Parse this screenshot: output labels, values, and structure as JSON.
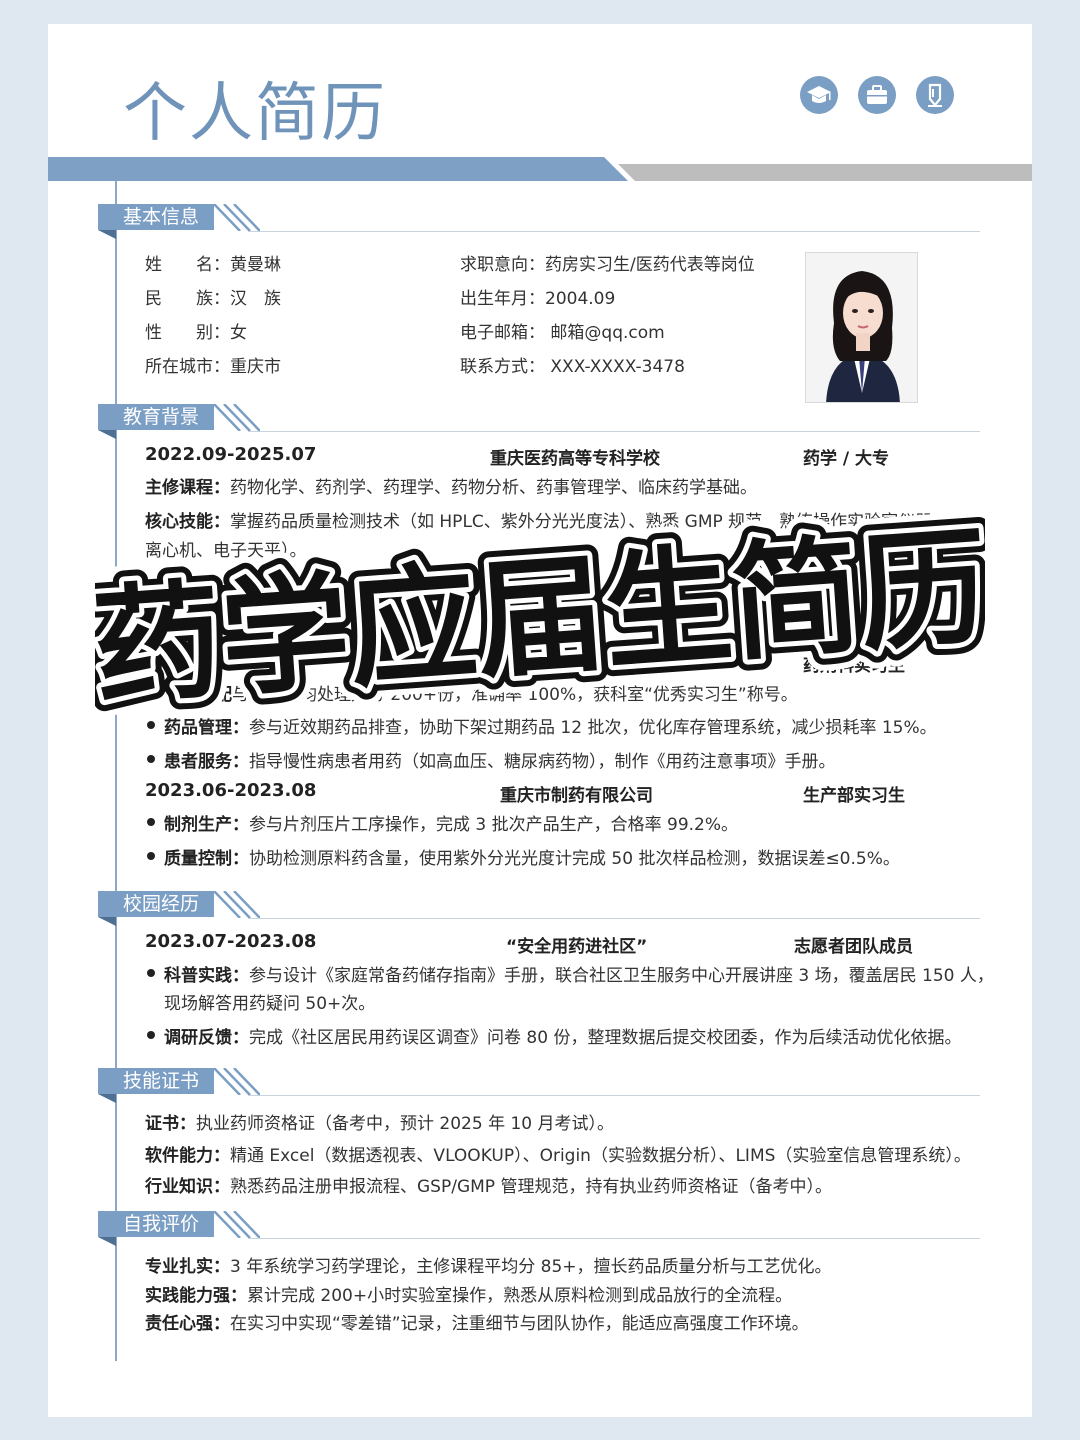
{
  "header": {
    "title": "个人简历",
    "icons": [
      "graduation-cap-icon",
      "briefcase-icon",
      "pen-icon"
    ]
  },
  "colors": {
    "accent": "#7b9ec4",
    "accent_dark": "#4f6f93",
    "band_gray": "#bdbdbd",
    "background": "#dfe8f0"
  },
  "sections": {
    "basic": "基本信息",
    "education": "教育背景",
    "campus": "校园经历",
    "skills": "技能证书",
    "self_eval": "自我评价"
  },
  "basic_info": {
    "name": "姓　　名：黄曼琳",
    "ethnicity": "民　　族：汉　族",
    "gender": "性　　别：女",
    "city": "所在城市：重庆市",
    "job_intent": "求职意向：药房实习生/医药代表等岗位",
    "birth": "出生年月：2004.09",
    "email": "电子邮箱： 邮箱@qq.com",
    "phone": "联系方式： XXX-XXXX-3478"
  },
  "education": {
    "period": "2022.09-2025.07",
    "school": "重庆医药高等专科学校",
    "major": "药学 / 大专",
    "courses_label": "主修课程：",
    "courses": "药物化学、药剂学、药理学、药物分析、药事管理学、临床药学基础。",
    "core_label": "核心技能：",
    "core_line1": "掌握药品质量检测技术（如 HPLC、紫外分光光度法）、熟悉 GMP 规范、熟练操作实验室仪器",
    "core_line2": "离心机、电子天平）。",
    "honor_label": "荣誉奖项：",
    "honor": "202"
  },
  "work": {
    "job1_role": "药剂科实习生",
    "job1_item1_text": "与发放：均处理处方 200+份，准确率 100%，获科室“优秀实习生”称号。",
    "job1_item2_label": "药品管理：",
    "job1_item2_text": "参与近效期药品排查，协助下架过期药品 12 批次，优化库存管理系统，减少损耗率 15%。",
    "job1_item3_label": "患者服务：",
    "job1_item3_text": "指导慢性病患者用药（如高血压、糖尿病药物），制作《用药注意事项》手册。",
    "job2_period": "2023.06-2023.08",
    "job2_company": "重庆市制药有限公司",
    "job2_role": "生产部实习生",
    "job2_item1_label": "制剂生产：",
    "job2_item1_text": "参与片剂压片工序操作，完成 3 批次产品生产，合格率 99.2%。",
    "job2_item2_label": "质量控制：",
    "job2_item2_text": "协助检测原料药含量，使用紫外分光光度计完成 50 批次样品检测，数据误差≤0.5%。"
  },
  "campus": {
    "period": "2023.07-2023.08",
    "activity": "“安全用药进社区”",
    "role": "志愿者团队成员",
    "item1_label": "科普实践：",
    "item1_line1": "参与设计《家庭常备药储存指南》手册，联合社区卫生服务中心开展讲座 3 场，覆盖居民 150 人，",
    "item1_line2": "现场解答用药疑问 50+次。",
    "item2_label": "调研反馈：",
    "item2_text": "完成《社区居民用药误区调查》问卷 80 份，整理数据后提交校团委，作为后续活动优化依据。"
  },
  "skills": {
    "cert_label": "证书：",
    "cert": "执业药师资格证（备考中，预计 2025 年 10 月考试）。",
    "software_label": "软件能力：",
    "software": "精通 Excel（数据透视表、VLOOKUP）、Origin（实验数据分析）、LIMS（实验室信息管理系统）。",
    "industry_label": "行业知识：",
    "industry": "熟悉药品注册申报流程、GSP/GMP 管理规范，持有执业药师资格证（备考中）。"
  },
  "self_eval": {
    "item1_label": "专业扎实：",
    "item1": "3 年系统学习药学理论，主修课程平均分 85+，擅长药品质量分析与工艺优化。",
    "item2_label": "实践能力强：",
    "item2": "累计完成 200+小时实验室操作，熟悉从原料检测到成品放行的全流程。",
    "item3_label": "责任心强：",
    "item3": "在实习中实现“零差错”记录，注重细节与团队协作，能适应高强度工作环境。"
  },
  "overlay_title": "药学应届生简历"
}
